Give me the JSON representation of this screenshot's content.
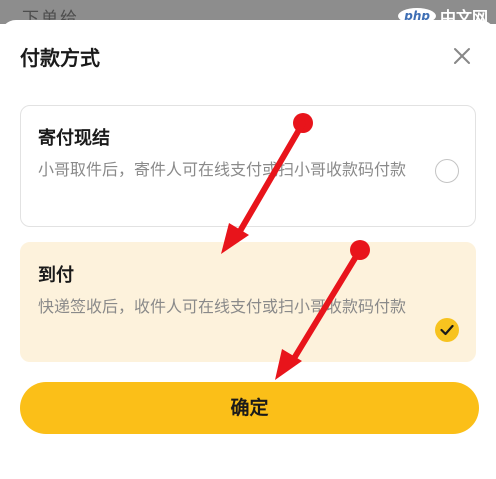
{
  "background_page": {
    "partial_text": "下单给"
  },
  "watermark": {
    "logo": "php",
    "text": "中文网"
  },
  "dialog": {
    "title": "付款方式",
    "close_icon": "close-icon",
    "options": [
      {
        "title": "寄付现结",
        "description": "小哥取件后，寄件人可在线支付或扫小哥收款码付款",
        "selected": false
      },
      {
        "title": "到付",
        "description": "快递签收后，收件人可在线支付或扫小哥收款码付款",
        "selected": true
      }
    ],
    "confirm_label": "确定"
  },
  "colors": {
    "accent": "#fbbf18",
    "selected_bg": "#fdf2dc",
    "annotation_arrow": "#e8141b"
  }
}
